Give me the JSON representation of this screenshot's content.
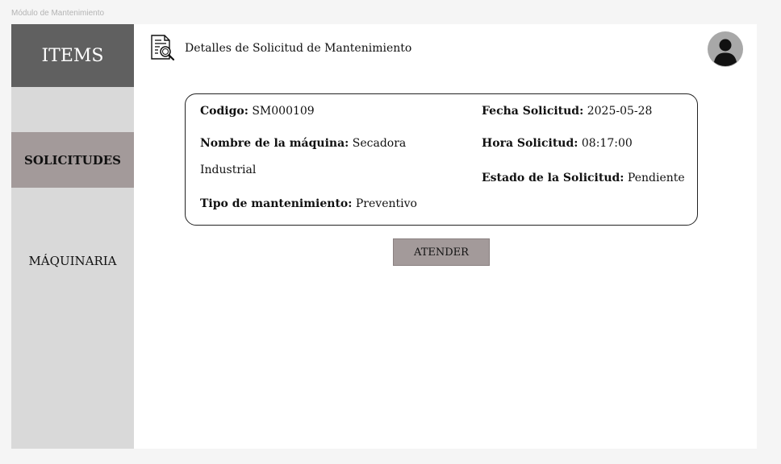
{
  "app": {
    "caption": "Módulo de Mantenimiento"
  },
  "sidebar": {
    "header": "ITEMS",
    "items": [
      {
        "label": "SOLICITUDES",
        "active": true
      },
      {
        "label": "MÁQUINARIA",
        "active": false
      }
    ]
  },
  "header": {
    "title": "Detalles de Solicitud de Mantenimiento",
    "icon": "document-search-icon",
    "avatar_icon": "user-avatar-icon"
  },
  "request": {
    "codigo_label": "Codigo:",
    "codigo_value": "SM000109",
    "maquina_label": "Nombre de la máquina:",
    "maquina_value_line1": "Secadora",
    "maquina_value_line2": "Industrial",
    "tipo_label": "Tipo de mantenimiento:",
    "tipo_value": "Preventivo",
    "fecha_label": "Fecha Solicitud:",
    "fecha_value": "2025-05-28",
    "hora_label": "Hora Solicitud:",
    "hora_value": "08:17:00",
    "estado_label": "Estado de la Solicitud:",
    "estado_value": "Pendiente"
  },
  "actions": {
    "atender_label": "ATENDER"
  },
  "colors": {
    "sidebar_header": "#606060",
    "sidebar_bg": "#d9d9d9",
    "active_item": "#a39a9a",
    "button": "#a39a9a"
  }
}
